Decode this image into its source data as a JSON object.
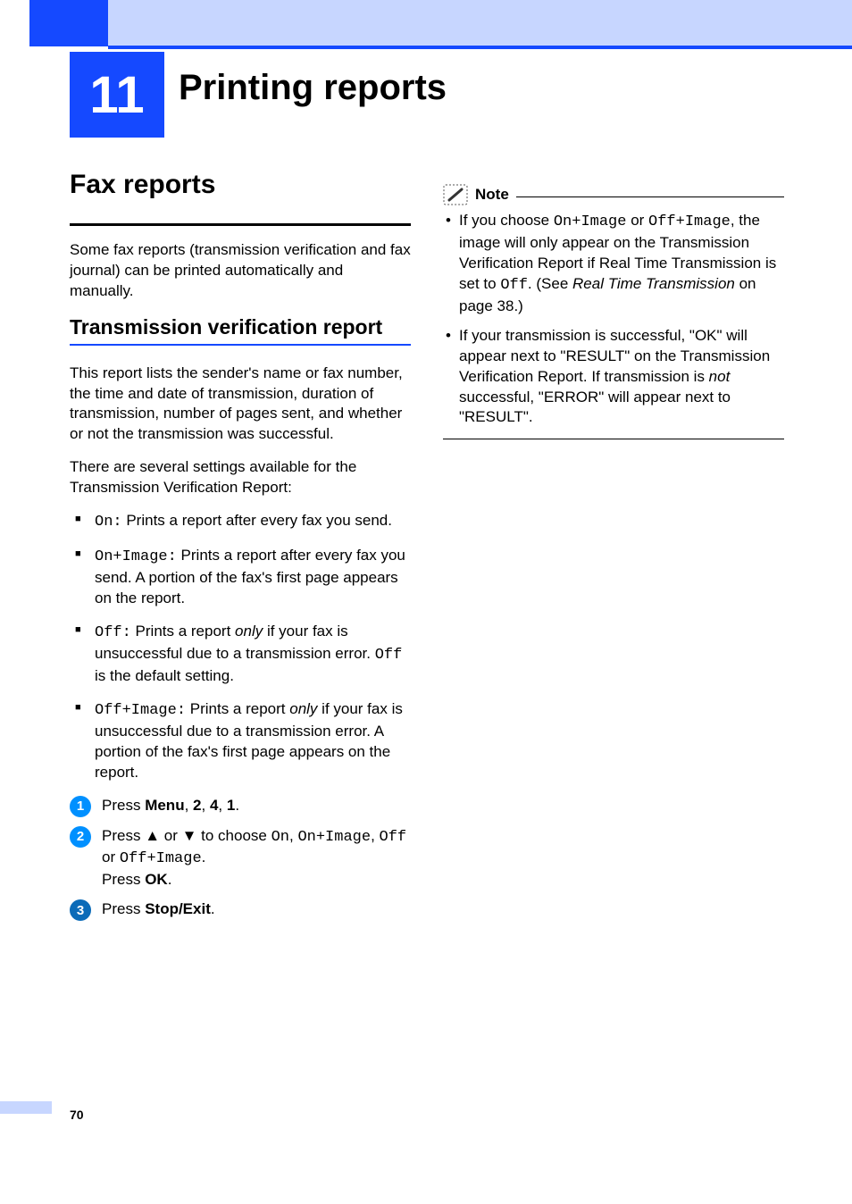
{
  "chapter": {
    "number": "11",
    "title": "Printing reports"
  },
  "left": {
    "h1": "Fax reports",
    "intro": "Some fax reports (transmission verification and fax journal) can be printed automatically and manually.",
    "h2": "Transmission verification report",
    "desc1": "This report lists the sender's name or fax number, the time and date of transmission, duration of transmission, number of pages sent, and whether or not the transmission was successful.",
    "desc2": "There are several settings available for the Transmission Verification Report:",
    "bullets": {
      "on_label": "On:",
      "on_text": " Prints a report after every fax you send.",
      "onimg_label": "On+Image:",
      "onimg_text": " Prints a report after every fax you send. A portion of the fax's first page appears on the report.",
      "off_label": "Off:",
      "off_prefix": " Prints a report ",
      "off_only": "only",
      "off_suffix": " if your fax is unsuccessful due to a transmission error. ",
      "off_code": "Off",
      "off_end": " is the default setting.",
      "offimg_label": "Off+Image:",
      "offimg_prefix": " Prints a report ",
      "offimg_only": "only",
      "offimg_suffix": " if your fax is unsuccessful due to a transmission error. A portion of the fax's first page appears on the report."
    },
    "steps": {
      "s1_pre": "Press ",
      "s1_b1": "Menu",
      "s1_c1": ", ",
      "s1_b2": "2",
      "s1_c2": ", ",
      "s1_b3": "4",
      "s1_c3": ", ",
      "s1_b4": "1",
      "s1_end": ".",
      "s2_pre": "Press ",
      "s2_up": "▲",
      "s2_or1": " or ",
      "s2_down": "▼",
      "s2_choose": " to choose ",
      "s2_on": "On",
      "s2_comma1": ", ",
      "s2_onimg": "On+Image",
      "s2_comma2": ", ",
      "s2_off": "Off",
      "s2_or2": " or ",
      "s2_offimg": "Off+Image",
      "s2_period": ".",
      "s2_press": "Press ",
      "s2_ok": "OK",
      "s2_end2": ".",
      "s3_pre": "Press ",
      "s3_b1": "Stop/Exit",
      "s3_end": "."
    }
  },
  "right": {
    "note_label": "Note",
    "n1_pre": "If you choose ",
    "n1_onimg": "On+Image",
    "n1_or": " or ",
    "n1_offimg": "Off+Image",
    "n1_mid": ", the image will only appear on the Transmission Verification Report if Real Time Transmission is set to ",
    "n1_off": "Off",
    "n1_dot": ". (See ",
    "n1_ital": "Real Time Transmission",
    "n1_end": " on page 38.)",
    "n2_a": "If your transmission is successful, \"OK\" will appear next to \"RESULT\" on the Transmission Verification Report. If transmission is ",
    "n2_not": "not",
    "n2_b": " successful, \"ERROR\" will appear next to \"RESULT\"."
  },
  "footer": {
    "page": "70"
  }
}
